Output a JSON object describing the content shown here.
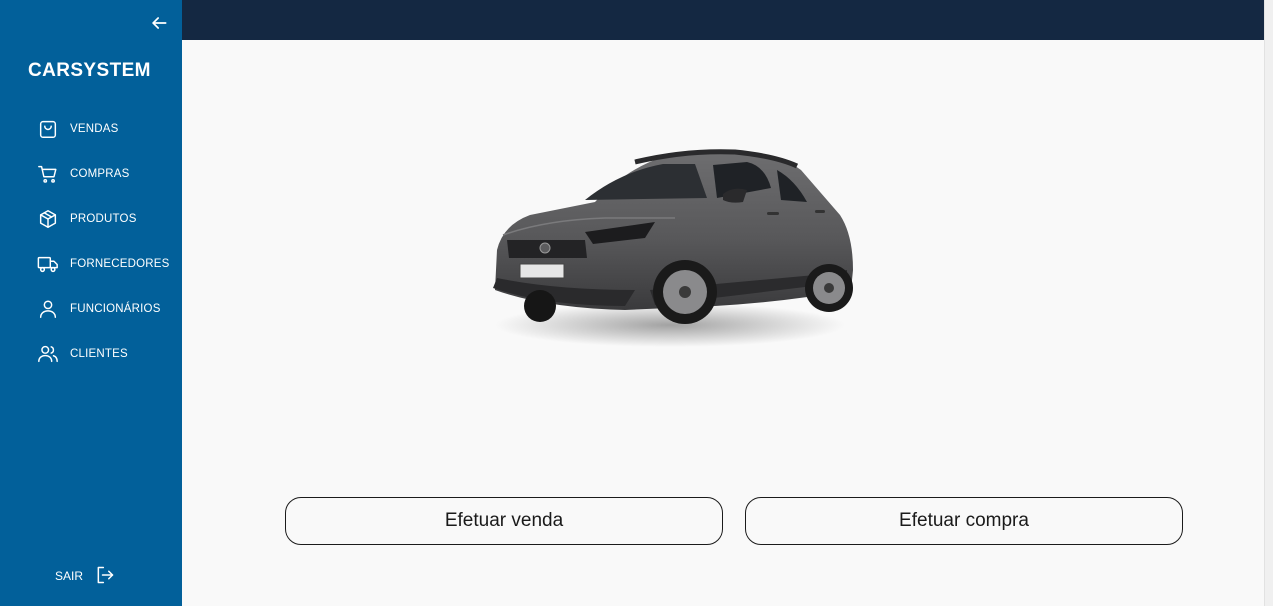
{
  "sidebar": {
    "brand": "CARSYSTEM",
    "items": [
      {
        "label": "VENDAS",
        "icon": "shopping-bag-icon"
      },
      {
        "label": "COMPRAS",
        "icon": "shopping-cart-icon"
      },
      {
        "label": "PRODUTOS",
        "icon": "box-icon"
      },
      {
        "label": "FORNECEDORES",
        "icon": "truck-icon"
      },
      {
        "label": "FUNCIONÁRIOS",
        "icon": "user-icon"
      },
      {
        "label": "CLIENTES",
        "icon": "users-icon"
      }
    ],
    "logout_label": "SAIR",
    "logout_icon": "logout-icon",
    "collapse_icon": "arrow-left-icon"
  },
  "main": {
    "hero_image": "gray-hatchback-car",
    "actions": {
      "sell_label": "Efetuar venda",
      "buy_label": "Efetuar compra"
    }
  },
  "colors": {
    "sidebar": "#02609a",
    "topbar": "#142842",
    "background": "#f9f9f9",
    "button_border": "#1b1b1b"
  }
}
